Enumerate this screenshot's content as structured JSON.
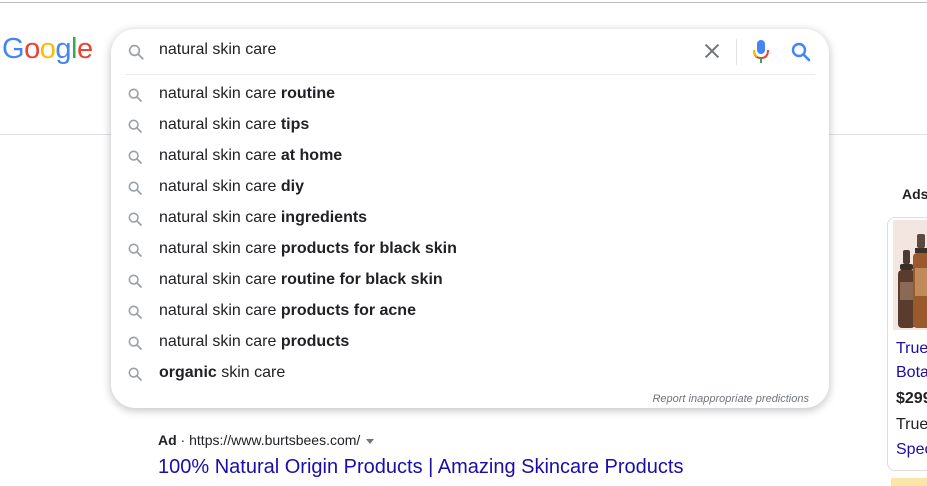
{
  "logo": {
    "text": "Google",
    "letters": [
      "G",
      "o",
      "o",
      "g",
      "l",
      "e"
    ],
    "colors": [
      "#4285F4",
      "#EA4335",
      "#FBBC05",
      "#4285F4",
      "#34A853",
      "#EA4335"
    ]
  },
  "search": {
    "query": "natural skin care"
  },
  "icons": {
    "search": "magnifier-icon",
    "clear": "close-icon",
    "voice": "microphone-icon",
    "submit": "search-icon"
  },
  "suggestions": [
    {
      "plain": "natural skin care ",
      "bold": "routine"
    },
    {
      "plain": "natural skin care ",
      "bold": "tips"
    },
    {
      "plain": "natural skin care ",
      "bold": "at home"
    },
    {
      "plain": "natural skin care ",
      "bold": "diy"
    },
    {
      "plain": "natural skin care ",
      "bold": "ingredients"
    },
    {
      "plain": "natural skin care ",
      "bold": "products for black skin"
    },
    {
      "plain": "natural skin care ",
      "bold": "routine for black skin"
    },
    {
      "plain": "natural skin care ",
      "bold": "products for acne"
    },
    {
      "plain": "natural skin care ",
      "bold": "products"
    },
    {
      "bold": "organic",
      "plain": " skin care"
    }
  ],
  "report_link": "Report inappropriate predictions",
  "ad": {
    "label": "Ad",
    "separator": " · ",
    "url": "https://www.burtsbees.com/",
    "title": "100% Natural Origin Products | Amazing Skincare Products"
  },
  "side_ads": {
    "label": "Ads",
    "card": {
      "title_line1": "True",
      "title_line2": "Bota",
      "price": "$299",
      "merchant": "True",
      "note": "Spec"
    }
  },
  "colors": {
    "link": "#1a0dab",
    "text": "#202124",
    "muted": "#70757a"
  }
}
